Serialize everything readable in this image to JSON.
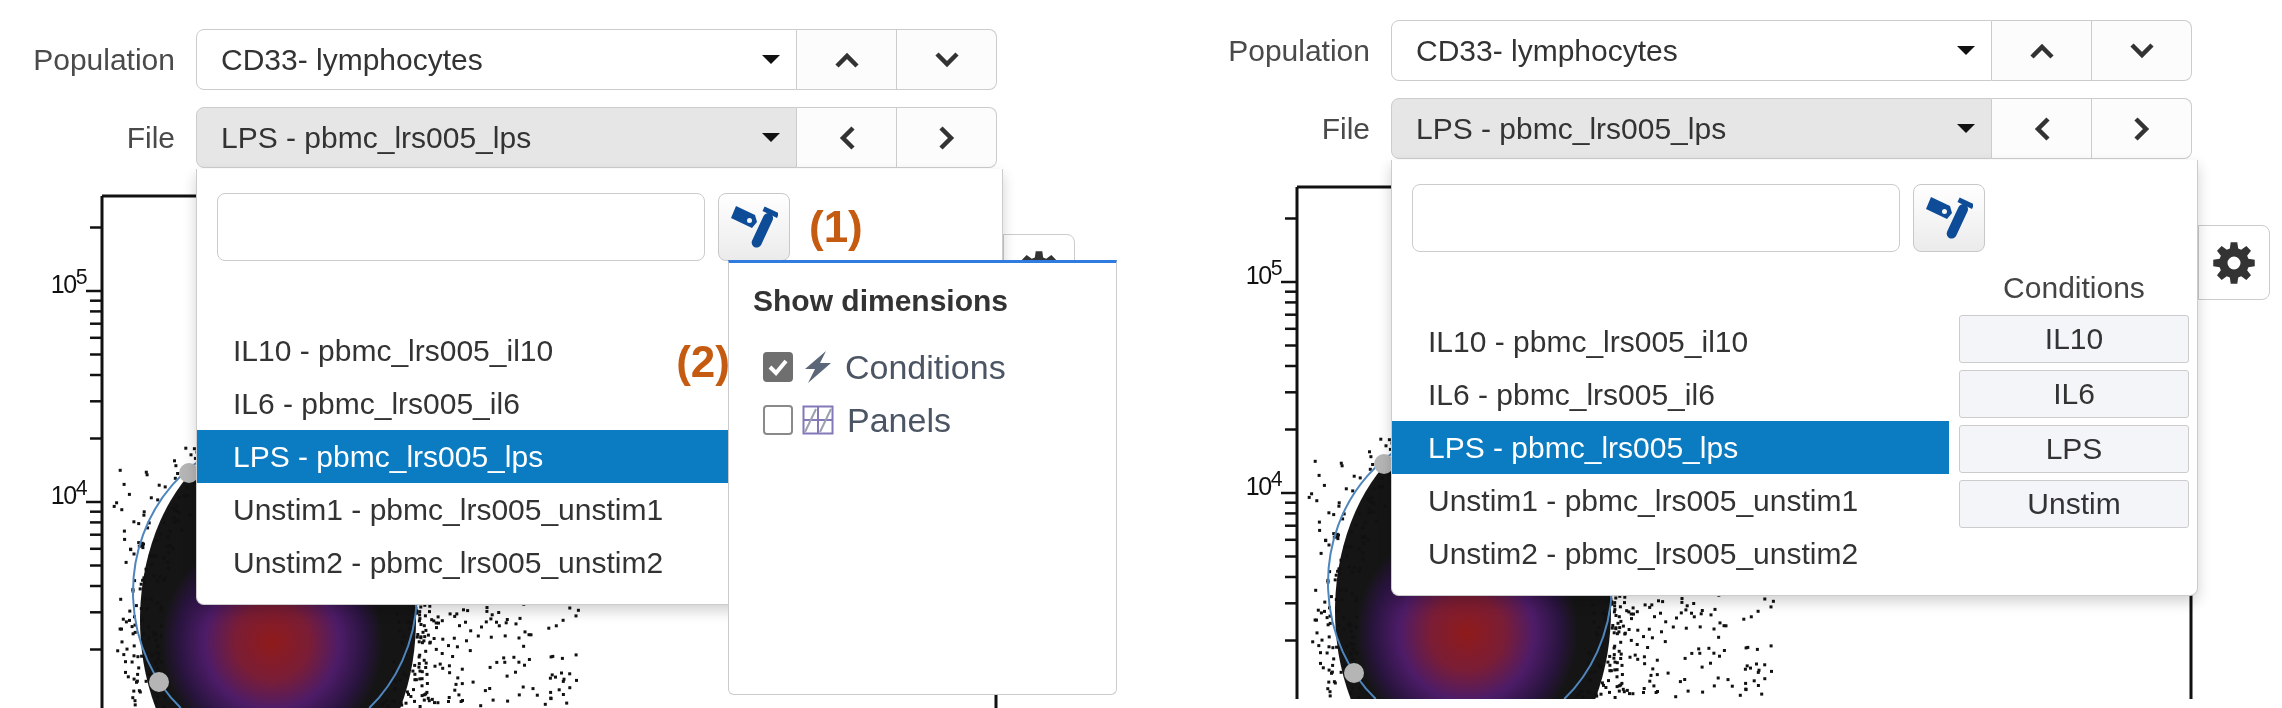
{
  "panels": [
    {
      "selectors": [
        {
          "kind": "vertical",
          "label": "Population",
          "value": "CD33- lymphocytes",
          "open": false
        },
        {
          "kind": "horizontal",
          "label": "File",
          "value": "LPS - pbmc_lrs005_lps",
          "open": true,
          "menu": {
            "filter_annotation": "(1)",
            "items": [
              {
                "label": "IL10 - pbmc_lrs005_il10",
                "selected": false
              },
              {
                "label": "IL6 - pbmc_lrs005_il6",
                "selected": false
              },
              {
                "label": "LPS - pbmc_lrs005_lps",
                "selected": true
              },
              {
                "label": "Unstim1 - pbmc_lrs005_unstim1",
                "selected": false
              },
              {
                "label": "Unstim2 - pbmc_lrs005_unstim2",
                "selected": false
              }
            ]
          }
        }
      ],
      "dimensions_menu": {
        "title": "Show dimensions",
        "options": [
          {
            "kind": "conditions",
            "label": "Conditions",
            "checked": true,
            "annotation": "(2)"
          },
          {
            "kind": "panels",
            "label": "Panels",
            "checked": false
          }
        ]
      },
      "plot": {
        "y_tick_labels": [
          "10$^{5}$",
          "10$^{4}$"
        ]
      }
    },
    {
      "selectors": [
        {
          "kind": "vertical",
          "label": "Population",
          "value": "CD33- lymphocytes",
          "open": false
        },
        {
          "kind": "horizontal",
          "label": "File",
          "value": "LPS - pbmc_lrs005_lps",
          "open": true,
          "menu": {
            "items": [
              {
                "label": "IL10 - pbmc_lrs005_il10",
                "selected": false
              },
              {
                "label": "IL6 - pbmc_lrs005_il6",
                "selected": false
              },
              {
                "label": "LPS - pbmc_lrs005_lps",
                "selected": true
              },
              {
                "label": "Unstim1 - pbmc_lrs005_unstim1",
                "selected": false
              },
              {
                "label": "Unstim2 - pbmc_lrs005_unstim2",
                "selected": false
              }
            ],
            "conditions": {
              "header": "Conditions",
              "values": [
                "IL10",
                "IL6",
                "LPS",
                "Unstim"
              ]
            }
          }
        }
      ],
      "plot": {
        "y_tick_labels": [
          "10$^{5}$",
          "10$^{4}$"
        ]
      }
    }
  ]
}
